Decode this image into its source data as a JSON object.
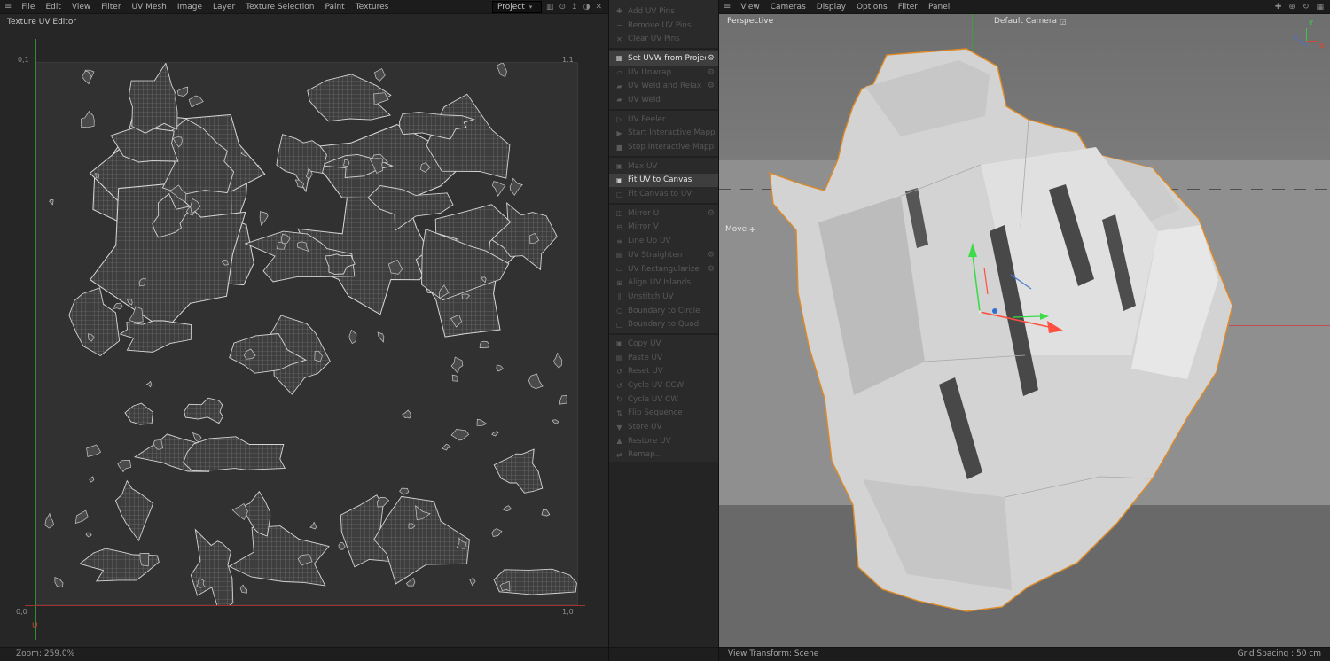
{
  "icons": {
    "hamburger": "≡",
    "gear": "⚙",
    "select_arrow": "▾",
    "camera_menu": "◲",
    "move_cursor": "✚"
  },
  "left_menubar": {
    "items": [
      "File",
      "Edit",
      "View",
      "Filter",
      "UV Mesh",
      "Image",
      "Layer",
      "Texture Selection",
      "Paint",
      "Textures"
    ],
    "project_dropdown": "Project",
    "toolbar_icons": [
      {
        "name": "histogram-icon",
        "glyph": "▥"
      },
      {
        "name": "lock-icon",
        "glyph": "⊙"
      },
      {
        "name": "upload-icon",
        "glyph": "↥"
      },
      {
        "name": "palette-icon",
        "glyph": "◑"
      },
      {
        "name": "close-icon",
        "glyph": "✕"
      }
    ]
  },
  "right_menubar": {
    "items": [
      "View",
      "Cameras",
      "Display",
      "Options",
      "Filter",
      "Panel"
    ],
    "toolbar_icons": [
      {
        "name": "pan-icon",
        "glyph": "✚"
      },
      {
        "name": "zoom-icon",
        "glyph": "⊕"
      },
      {
        "name": "rotate-icon",
        "glyph": "↻"
      },
      {
        "name": "layout-icon",
        "glyph": "▦"
      }
    ]
  },
  "uv_editor": {
    "title": "Texture UV Editor",
    "corners": {
      "tl": "0,1",
      "tr": "1,1",
      "bl": "0,0",
      "br": "1,0"
    },
    "u_axis_label": "U",
    "zoom_status": "Zoom: 259.0%"
  },
  "command_panel": {
    "groups": [
      {
        "items": [
          {
            "label": "Add UV Pins",
            "icon": "✚",
            "enabled": false
          },
          {
            "label": "Remove UV Pins",
            "icon": "−",
            "enabled": false
          },
          {
            "label": "Clear UV Pins",
            "icon": "✕",
            "enabled": false
          }
        ]
      },
      {
        "items": [
          {
            "label": "Set UVW from Projection",
            "icon": "▦",
            "enabled": true,
            "selected": true,
            "gear": "bright"
          },
          {
            "label": "UV Unwrap",
            "icon": "▱",
            "enabled": false,
            "gear": "dim"
          },
          {
            "label": "UV Weld and Relax",
            "icon": "▰",
            "enabled": false,
            "gear": "dim"
          },
          {
            "label": "UV Weld",
            "icon": "▰",
            "enabled": false
          }
        ]
      },
      {
        "items": [
          {
            "label": "UV Peeler",
            "icon": "▷",
            "enabled": false
          },
          {
            "label": "Start Interactive Mapping",
            "icon": "▶",
            "enabled": false
          },
          {
            "label": "Stop Interactive Mapping",
            "icon": "■",
            "enabled": false
          }
        ]
      },
      {
        "items": [
          {
            "label": "Max UV",
            "icon": "▣",
            "enabled": false
          },
          {
            "label": "Fit UV to Canvas",
            "icon": "▣",
            "enabled": true,
            "selected": true
          },
          {
            "label": "Fit Canvas to UV",
            "icon": "▢",
            "enabled": false
          }
        ]
      },
      {
        "items": [
          {
            "label": "Mirror U",
            "icon": "◫",
            "enabled": false,
            "gear": "dim"
          },
          {
            "label": "Mirror V",
            "icon": "⊟",
            "enabled": false
          },
          {
            "label": "Line Up UV",
            "icon": "≡",
            "enabled": false
          },
          {
            "label": "UV Straighten",
            "icon": "▤",
            "enabled": false,
            "gear": "dim"
          },
          {
            "label": "UV Rectangularize",
            "icon": "▭",
            "enabled": false,
            "gear": "dim"
          },
          {
            "label": "Align UV Islands",
            "icon": "⊞",
            "enabled": false
          },
          {
            "label": "Unstitch UV",
            "icon": "∥",
            "enabled": false
          },
          {
            "label": "Boundary to Circle",
            "icon": "○",
            "enabled": false
          },
          {
            "label": "Boundary to Quad",
            "icon": "▢",
            "enabled": false
          }
        ]
      },
      {
        "items": [
          {
            "label": "Copy UV",
            "icon": "▣",
            "enabled": false
          },
          {
            "label": "Paste UV",
            "icon": "▤",
            "enabled": false
          },
          {
            "label": "Reset UV",
            "icon": "↺",
            "enabled": false
          },
          {
            "label": "Cycle UV CCW",
            "icon": "↺",
            "enabled": false
          },
          {
            "label": "Cycle UV CW",
            "icon": "↻",
            "enabled": false
          },
          {
            "label": "Flip Sequence",
            "icon": "⇅",
            "enabled": false
          },
          {
            "label": "Store UV",
            "icon": "▼",
            "enabled": false
          },
          {
            "label": "Restore UV",
            "icon": "▲",
            "enabled": false
          },
          {
            "label": "Remap...",
            "icon": "⇄",
            "enabled": false
          }
        ]
      }
    ]
  },
  "viewport": {
    "view_label": "Perspective",
    "camera_label": "Default Camera",
    "tool_label": "Move",
    "bottom_left": "View Transform: Scene",
    "bottom_right": "Grid Spacing : 50 cm",
    "axis": {
      "x": "X",
      "y": "Y",
      "z": "Z"
    }
  },
  "colors": {
    "selection_orange": "#de8a26",
    "axis_green": "#3fc24c",
    "axis_red": "#ff5040",
    "axis_blue": "#2f6fd0"
  }
}
